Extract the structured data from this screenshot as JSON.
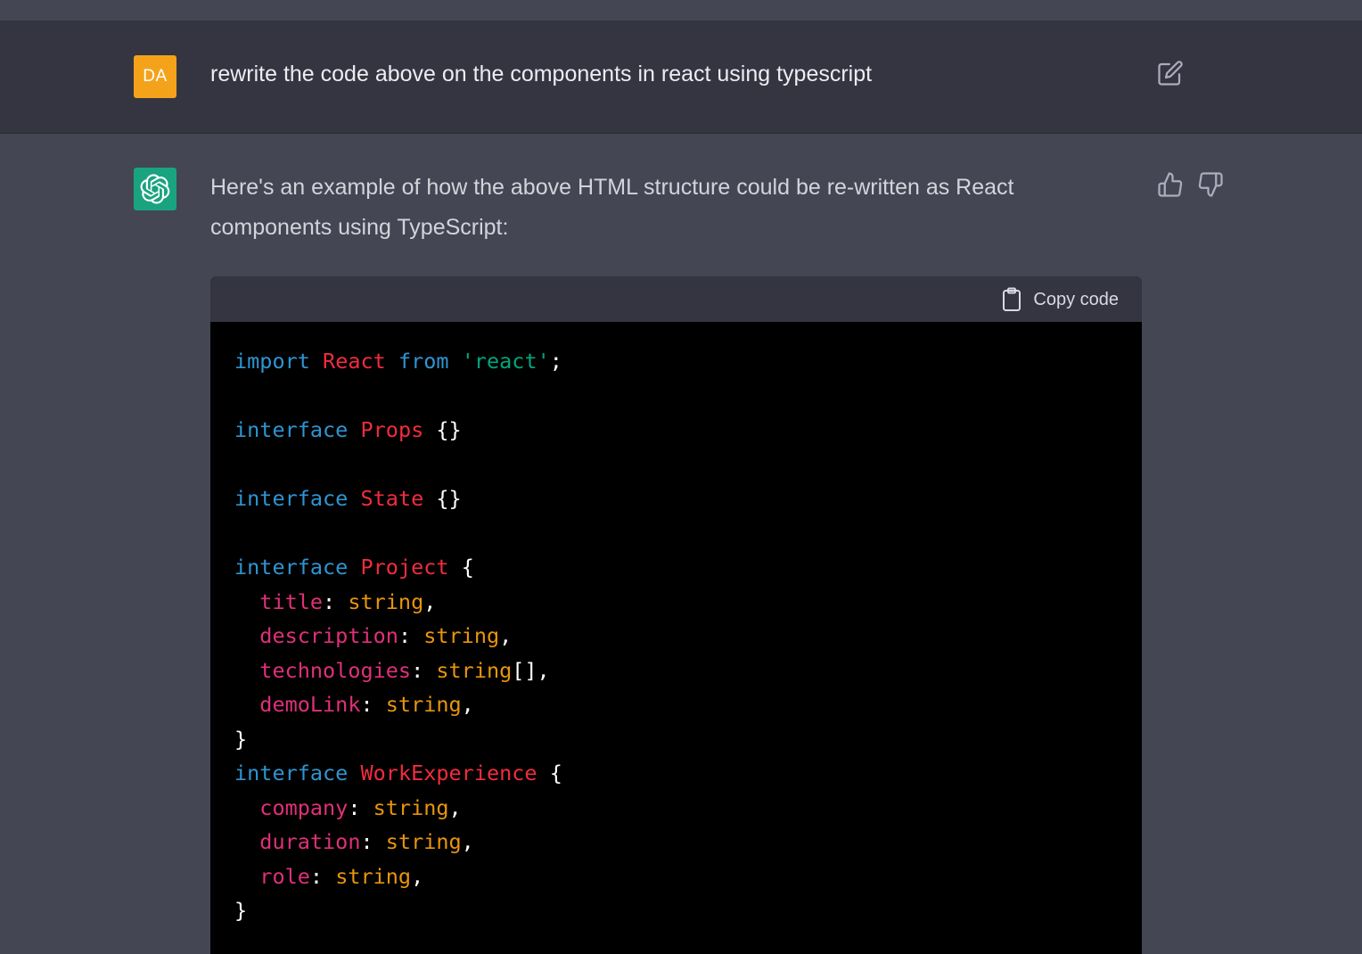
{
  "user_message": {
    "avatar_initials": "DA",
    "text": "rewrite the code above on the components in react using typescript"
  },
  "assistant_message": {
    "intro": "Here's an example of how the above HTML structure could be re-written as React components using TypeScript:",
    "code_block": {
      "copy_label": "Copy code",
      "tokens": {
        "l1_import": "import",
        "l1_react": "React",
        "l1_from": "from",
        "l1_str": "'react'",
        "l1_semi": ";",
        "l3_interface": "interface",
        "l3_name": "Props",
        "l3_body": "{}",
        "l5_interface": "interface",
        "l5_name": "State",
        "l5_body": "{}",
        "l7_interface": "interface",
        "l7_name": "Project",
        "l7_open": "{",
        "l8_prop": "title",
        "l8_colon": ": ",
        "l8_type": "string",
        "l8_comma": ",",
        "l9_prop": "description",
        "l9_colon": ": ",
        "l9_type": "string",
        "l9_comma": ",",
        "l10_prop": "technologies",
        "l10_colon": ": ",
        "l10_type": "string",
        "l10_rest": "[],",
        "l11_prop": "demoLink",
        "l11_colon": ": ",
        "l11_type": "string",
        "l11_comma": ",",
        "l12_close": "}",
        "l13_interface": "interface",
        "l13_name": "WorkExperience",
        "l13_open": "{",
        "l14_prop": "company",
        "l14_colon": ": ",
        "l14_type": "string",
        "l14_comma": ",",
        "l15_prop": "duration",
        "l15_colon": ": ",
        "l15_type": "string",
        "l15_comma": ",",
        "l16_prop": "role",
        "l16_colon": ": ",
        "l16_type": "string",
        "l16_comma": ",",
        "l17_close": "}"
      }
    }
  },
  "icons": {
    "edit": "edit-icon",
    "thumbs_up": "thumbs-up-icon",
    "thumbs_down": "thumbs-down-icon",
    "clipboard": "clipboard-icon",
    "assistant_logo": "openai-logo-icon"
  },
  "colors": {
    "user_avatar": "#f5a21b",
    "assistant_avatar": "#19a37f",
    "keyword": "#2e95d3",
    "class_name": "#f22c3d",
    "string": "#00a67d",
    "property": "#df3079",
    "type": "#e9950c"
  }
}
